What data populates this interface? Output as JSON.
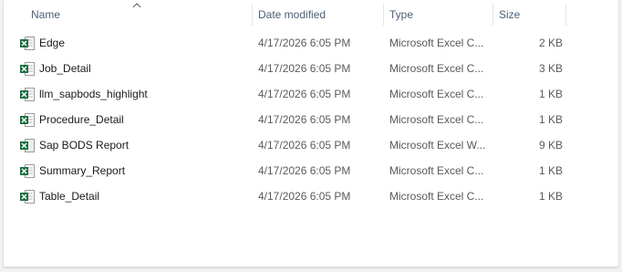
{
  "columns": {
    "name": "Name",
    "date_modified": "Date modified",
    "type": "Type",
    "size": "Size"
  },
  "sort": {
    "column": "name",
    "direction": "ascending"
  },
  "colors": {
    "excel_green": "#1d6f42",
    "header_text": "#4c607a"
  },
  "files": [
    {
      "name": "Edge",
      "date": "4/17/2026 6:05 PM",
      "type": "Microsoft Excel C...",
      "size": "2 KB",
      "icon": "excel-csv-icon"
    },
    {
      "name": "Job_Detail",
      "date": "4/17/2026 6:05 PM",
      "type": "Microsoft Excel C...",
      "size": "3 KB",
      "icon": "excel-csv-icon"
    },
    {
      "name": "llm_sapbods_highlight",
      "date": "4/17/2026 6:05 PM",
      "type": "Microsoft Excel C...",
      "size": "1 KB",
      "icon": "excel-csv-icon"
    },
    {
      "name": "Procedure_Detail",
      "date": "4/17/2026 6:05 PM",
      "type": "Microsoft Excel C...",
      "size": "1 KB",
      "icon": "excel-csv-icon"
    },
    {
      "name": "Sap BODS Report",
      "date": "4/17/2026 6:05 PM",
      "type": "Microsoft Excel W...",
      "size": "9 KB",
      "icon": "excel-workbook-icon"
    },
    {
      "name": "Summary_Report",
      "date": "4/17/2026 6:05 PM",
      "type": "Microsoft Excel C...",
      "size": "1 KB",
      "icon": "excel-csv-icon"
    },
    {
      "name": "Table_Detail",
      "date": "4/17/2026 6:05 PM",
      "type": "Microsoft Excel C...",
      "size": "1 KB",
      "icon": "excel-csv-icon"
    }
  ]
}
